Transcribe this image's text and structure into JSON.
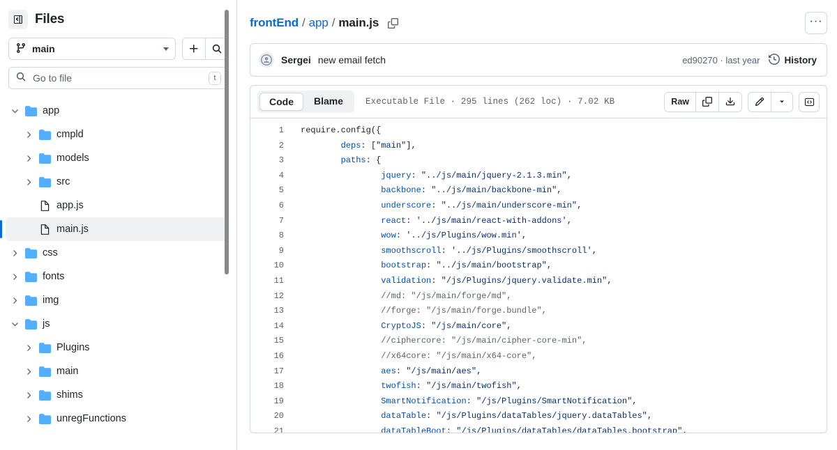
{
  "sidebar": {
    "toggle_icon": "sidebar-collapse-icon",
    "title": "Files",
    "branch": {
      "name": "main",
      "icon": "git-branch-icon"
    },
    "add_icon": "plus-icon",
    "search_icon": "search-icon",
    "file_search": {
      "placeholder": "Go to file",
      "value": "",
      "shortcut": "t"
    },
    "tree": [
      {
        "label": "app",
        "type": "folder",
        "depth": 0,
        "state": "expanded",
        "selected": false
      },
      {
        "label": "cmpld",
        "type": "folder",
        "depth": 1,
        "state": "collapsed",
        "selected": false
      },
      {
        "label": "models",
        "type": "folder",
        "depth": 1,
        "state": "collapsed",
        "selected": false
      },
      {
        "label": "src",
        "type": "folder",
        "depth": 1,
        "state": "collapsed",
        "selected": false
      },
      {
        "label": "app.js",
        "type": "file",
        "depth": 1,
        "state": "none",
        "selected": false
      },
      {
        "label": "main.js",
        "type": "file",
        "depth": 1,
        "state": "none",
        "selected": true
      },
      {
        "label": "css",
        "type": "folder",
        "depth": 0,
        "state": "collapsed",
        "selected": false
      },
      {
        "label": "fonts",
        "type": "folder",
        "depth": 0,
        "state": "collapsed",
        "selected": false
      },
      {
        "label": "img",
        "type": "folder",
        "depth": 0,
        "state": "collapsed",
        "selected": false
      },
      {
        "label": "js",
        "type": "folder",
        "depth": 0,
        "state": "expanded",
        "selected": false
      },
      {
        "label": "Plugins",
        "type": "folder",
        "depth": 1,
        "state": "collapsed",
        "selected": false
      },
      {
        "label": "main",
        "type": "folder",
        "depth": 1,
        "state": "collapsed",
        "selected": false
      },
      {
        "label": "shims",
        "type": "folder",
        "depth": 1,
        "state": "collapsed",
        "selected": false
      },
      {
        "label": "unregFunctions",
        "type": "folder",
        "depth": 1,
        "state": "collapsed",
        "selected": false
      }
    ]
  },
  "breadcrumb": {
    "repo": "frontEnd",
    "sep": "/",
    "folder": "app",
    "file": "main.js",
    "copy_path_icon": "copy-path-icon",
    "kebab_label": "···"
  },
  "commit": {
    "author": "Sergei",
    "message": "new email fetch",
    "meta": "ed90270 · last year",
    "history_label": "History",
    "history_icon": "history-icon",
    "avatar_icon": "avatar-icon"
  },
  "file_toolbar": {
    "tabs": [
      {
        "label": "Code",
        "active": true
      },
      {
        "label": "Blame",
        "active": false
      }
    ],
    "meta": "Executable File · 295 lines (262 loc) · 7.02 KB",
    "raw_label": "Raw",
    "copy_icon": "copy-icon",
    "download_icon": "download-icon",
    "edit_icon": "pencil-icon",
    "edit_caret_icon": "chevron-down-icon",
    "symbols_icon": "code-brackets-icon"
  },
  "code": {
    "line_numbers": [
      1,
      2,
      3,
      4,
      5,
      6,
      7,
      8,
      9,
      10,
      11,
      12,
      13,
      14,
      15,
      16,
      17,
      18,
      19,
      20,
      21
    ],
    "lines": [
      [
        {
          "t": "pun",
          "v": "require"
        },
        {
          "t": "pun",
          "v": ".config({"
        }
      ],
      [
        {
          "t": "pun",
          "v": "        "
        },
        {
          "t": "prop",
          "v": "deps"
        },
        {
          "t": "pun",
          "v": ": ["
        },
        {
          "t": "str",
          "v": "\"main\""
        },
        {
          "t": "pun",
          "v": "],"
        }
      ],
      [
        {
          "t": "pun",
          "v": "        "
        },
        {
          "t": "prop",
          "v": "paths"
        },
        {
          "t": "pun",
          "v": ": {"
        }
      ],
      [
        {
          "t": "pun",
          "v": "                "
        },
        {
          "t": "prop",
          "v": "jquery"
        },
        {
          "t": "pun",
          "v": ": "
        },
        {
          "t": "str",
          "v": "\"../js/main/jquery-2.1.3.min\""
        },
        {
          "t": "pun",
          "v": ","
        }
      ],
      [
        {
          "t": "pun",
          "v": "                "
        },
        {
          "t": "prop",
          "v": "backbone"
        },
        {
          "t": "pun",
          "v": ": "
        },
        {
          "t": "str",
          "v": "\"../js/main/backbone-min\""
        },
        {
          "t": "pun",
          "v": ","
        }
      ],
      [
        {
          "t": "pun",
          "v": "                "
        },
        {
          "t": "prop",
          "v": "underscore"
        },
        {
          "t": "pun",
          "v": ": "
        },
        {
          "t": "str",
          "v": "\"../js/main/underscore-min\""
        },
        {
          "t": "pun",
          "v": ","
        }
      ],
      [
        {
          "t": "pun",
          "v": "                "
        },
        {
          "t": "prop",
          "v": "react"
        },
        {
          "t": "pun",
          "v": ": "
        },
        {
          "t": "str",
          "v": "'../js/main/react-with-addons'"
        },
        {
          "t": "pun",
          "v": ","
        }
      ],
      [
        {
          "t": "pun",
          "v": "                "
        },
        {
          "t": "prop",
          "v": "wow"
        },
        {
          "t": "pun",
          "v": ": "
        },
        {
          "t": "str",
          "v": "'../js/Plugins/wow.min'"
        },
        {
          "t": "pun",
          "v": ","
        }
      ],
      [
        {
          "t": "pun",
          "v": "                "
        },
        {
          "t": "prop",
          "v": "smoothscroll"
        },
        {
          "t": "pun",
          "v": ": "
        },
        {
          "t": "str",
          "v": "'../js/Plugins/smoothscroll'"
        },
        {
          "t": "pun",
          "v": ","
        }
      ],
      [
        {
          "t": "pun",
          "v": "                "
        },
        {
          "t": "prop",
          "v": "bootstrap"
        },
        {
          "t": "pun",
          "v": ": "
        },
        {
          "t": "str",
          "v": "\"../js/main/bootstrap\""
        },
        {
          "t": "pun",
          "v": ","
        }
      ],
      [
        {
          "t": "pun",
          "v": "                "
        },
        {
          "t": "prop",
          "v": "validation"
        },
        {
          "t": "pun",
          "v": ": "
        },
        {
          "t": "str",
          "v": "\"/js/Plugins/jquery.validate.min\""
        },
        {
          "t": "pun",
          "v": ","
        }
      ],
      [
        {
          "t": "pun",
          "v": "                "
        },
        {
          "t": "com",
          "v": "//md: \"/js/main/forge/md\","
        }
      ],
      [
        {
          "t": "pun",
          "v": "                "
        },
        {
          "t": "com",
          "v": "//forge: \"/js/main/forge.bundle\","
        }
      ],
      [
        {
          "t": "pun",
          "v": "                "
        },
        {
          "t": "prop",
          "v": "CryptoJS"
        },
        {
          "t": "pun",
          "v": ": "
        },
        {
          "t": "str",
          "v": "\"/js/main/core\""
        },
        {
          "t": "pun",
          "v": ","
        }
      ],
      [
        {
          "t": "pun",
          "v": "                "
        },
        {
          "t": "com",
          "v": "//ciphercore: \"/js/main/cipher-core-min\","
        }
      ],
      [
        {
          "t": "pun",
          "v": "                "
        },
        {
          "t": "com",
          "v": "//x64core: \"/js/main/x64-core\","
        }
      ],
      [
        {
          "t": "pun",
          "v": "                "
        },
        {
          "t": "prop",
          "v": "aes"
        },
        {
          "t": "pun",
          "v": ": "
        },
        {
          "t": "str",
          "v": "\"/js/main/aes\""
        },
        {
          "t": "pun",
          "v": ","
        }
      ],
      [
        {
          "t": "pun",
          "v": "                "
        },
        {
          "t": "prop",
          "v": "twofish"
        },
        {
          "t": "pun",
          "v": ": "
        },
        {
          "t": "str",
          "v": "\"/js/main/twofish\""
        },
        {
          "t": "pun",
          "v": ","
        }
      ],
      [
        {
          "t": "pun",
          "v": "                "
        },
        {
          "t": "prop",
          "v": "SmartNotification"
        },
        {
          "t": "pun",
          "v": ": "
        },
        {
          "t": "str",
          "v": "\"/js/Plugins/SmartNotification\""
        },
        {
          "t": "pun",
          "v": ","
        }
      ],
      [
        {
          "t": "pun",
          "v": "                "
        },
        {
          "t": "prop",
          "v": "dataTable"
        },
        {
          "t": "pun",
          "v": ": "
        },
        {
          "t": "str",
          "v": "\"/js/Plugins/dataTables/jquery.dataTables\""
        },
        {
          "t": "pun",
          "v": ","
        }
      ],
      [
        {
          "t": "pun",
          "v": "                "
        },
        {
          "t": "prop",
          "v": "dataTableBoot"
        },
        {
          "t": "pun",
          "v": ": "
        },
        {
          "t": "str",
          "v": "\"/js/Plugins/dataTables/dataTables.bootstrap\""
        },
        {
          "t": "pun",
          "v": ","
        }
      ]
    ]
  },
  "colors": {
    "accent": "#0969da",
    "border": "#d1d9e0",
    "muted": "#59636e",
    "folder": "#54aeff",
    "prop": "#0550ae",
    "string": "#0a3069",
    "comment": "#59636e"
  }
}
